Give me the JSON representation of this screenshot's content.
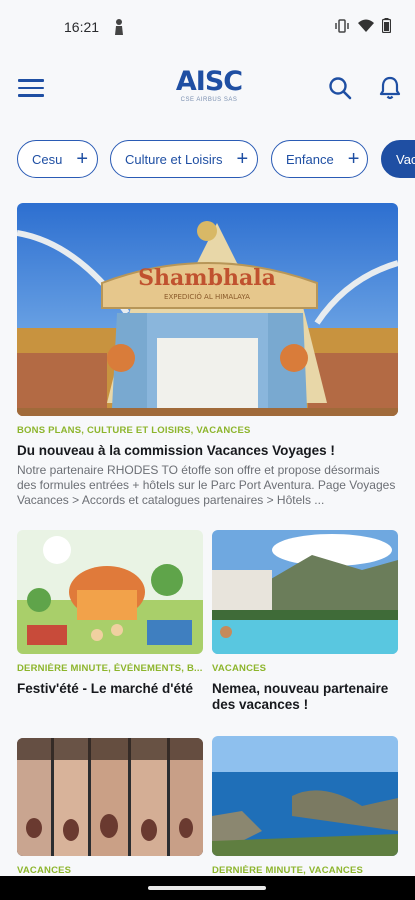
{
  "status": {
    "time": "16:21"
  },
  "header": {
    "logo_text": "AISC",
    "logo_sub": "CSE AIRBUS SAS"
  },
  "chips": [
    {
      "label": "Cesu"
    },
    {
      "label": "Culture et Loisirs"
    },
    {
      "label": "Enfance"
    },
    {
      "label": "Vac"
    }
  ],
  "articles": [
    {
      "category": "BONS PLANS, CULTURE ET LOISIRS, VACANCES",
      "title": "Du nouveau à la commission Vacances Voyages !",
      "excerpt": "Notre partenaire RHODES TO étoffe son offre et propose désormais des formules entrées + hôtels sur le Parc Port Aventura. Page Voyages Vacances > Accords et catalogues partenaires > Hôtels ...",
      "image_sign": "Shambhala",
      "image_sub": "EXPEDICIÓ AL HIMALAYA"
    },
    {
      "category": "DERNIÈRE MINUTE, ÉVÉNEMENTS, B...",
      "title": "Festiv'été - Le marché d'été"
    },
    {
      "category": "VACANCES",
      "title": "Nemea, nouveau partenaire des vacances !"
    },
    {
      "category": "VACANCES",
      "title": ""
    },
    {
      "category": "DERNIÈRE MINUTE, VACANCES",
      "title": ""
    }
  ],
  "colors": {
    "brand": "#1f4fa3",
    "category": "#8db52c"
  }
}
